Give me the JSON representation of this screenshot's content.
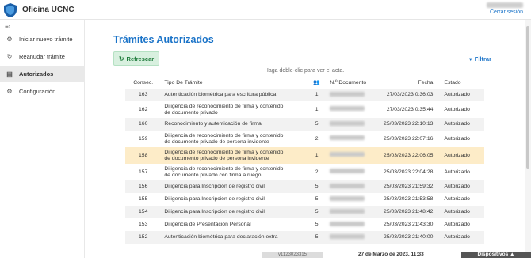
{
  "header": {
    "app_title": "Oficina UCNC",
    "logout": "Cerrar sesión",
    "menu_icon": "≡›",
    "logo_icon": "shield-logo"
  },
  "sidebar": {
    "items": [
      {
        "label": "Iniciar nuevo trámite",
        "icon": "⚙",
        "icon_name": "gear-icon"
      },
      {
        "label": "Reanudar trámite",
        "icon": "↻",
        "icon_name": "refresh-icon"
      },
      {
        "label": "Autorizados",
        "icon": "▤",
        "icon_name": "document-icon",
        "active": true
      },
      {
        "label": "Configuración",
        "icon": "⚙",
        "icon_name": "gear-icon"
      }
    ]
  },
  "main": {
    "title": "Trámites Autorizados",
    "refresh_label": "Refrescar",
    "refresh_icon": "↻",
    "filter_label": "Filtrar",
    "filter_icon": "▼",
    "hint": "Haga doble-clic para ver el acta."
  },
  "table": {
    "columns": {
      "consec": "Consec.",
      "tipo": "Tipo De Trámite",
      "user_icon": "👥",
      "documento": "N.º Documento",
      "fecha": "Fecha",
      "estado": "Estado"
    },
    "rows": [
      {
        "consec": "163",
        "tipo": [
          "Autenticación biométrica para escritura pública"
        ],
        "n": "1",
        "fecha": "27/03/2023 0:36:03",
        "estado": "Autorizado"
      },
      {
        "consec": "162",
        "tipo": [
          "Diligencia de reconocimiento de firma y contenido",
          "de documento privado"
        ],
        "n": "1",
        "fecha": "27/03/2023 0:35:44",
        "estado": "Autorizado"
      },
      {
        "consec": "160",
        "tipo": [
          "Reconocimiento y autenticación de firma"
        ],
        "n": "5",
        "fecha": "25/03/2023 22:10:13",
        "estado": "Autorizado"
      },
      {
        "consec": "159",
        "tipo": [
          "Diligencia de reconocimiento de firma y contenido",
          "de documento privado de persona invidente"
        ],
        "n": "2",
        "fecha": "25/03/2023 22:07:16",
        "estado": "Autorizado"
      },
      {
        "consec": "158",
        "tipo": [
          "Diligencia de reconocimiento de firma y contenido",
          "de documento privado de persona invidente"
        ],
        "n": "1",
        "fecha": "25/03/2023 22:06:05",
        "estado": "Autorizado",
        "highlight": true
      },
      {
        "consec": "157",
        "tipo": [
          "Diligencia de reconocimiento de firma y contenido",
          "de documento privado con firma a ruego"
        ],
        "n": "2",
        "fecha": "25/03/2023 22:04:28",
        "estado": "Autorizado"
      },
      {
        "consec": "156",
        "tipo": [
          "Diligencia para Inscripción de registro civil"
        ],
        "n": "5",
        "fecha": "25/03/2023 21:59:32",
        "estado": "Autorizado"
      },
      {
        "consec": "155",
        "tipo": [
          "Diligencia para Inscripción de registro civil"
        ],
        "n": "5",
        "fecha": "25/03/2023 21:53:58",
        "estado": "Autorizado"
      },
      {
        "consec": "154",
        "tipo": [
          "Diligencia para Inscripción de registro civil"
        ],
        "n": "5",
        "fecha": "25/03/2023 21:48:42",
        "estado": "Autorizado"
      },
      {
        "consec": "153",
        "tipo": [
          "Diligencia de Presentación Personal"
        ],
        "n": "5",
        "fecha": "25/03/2023 21:43:30",
        "estado": "Autorizado"
      },
      {
        "consec": "152",
        "tipo": [
          "Autenticación biométrica para declaración extra-"
        ],
        "n": "5",
        "fecha": "25/03/2023 21:40:00",
        "estado": "Autorizado"
      }
    ]
  },
  "footer": {
    "version": "v1123023315",
    "date": "27 de Marzo de 2023, 11:33",
    "devices": "Dispositivos ▲"
  }
}
